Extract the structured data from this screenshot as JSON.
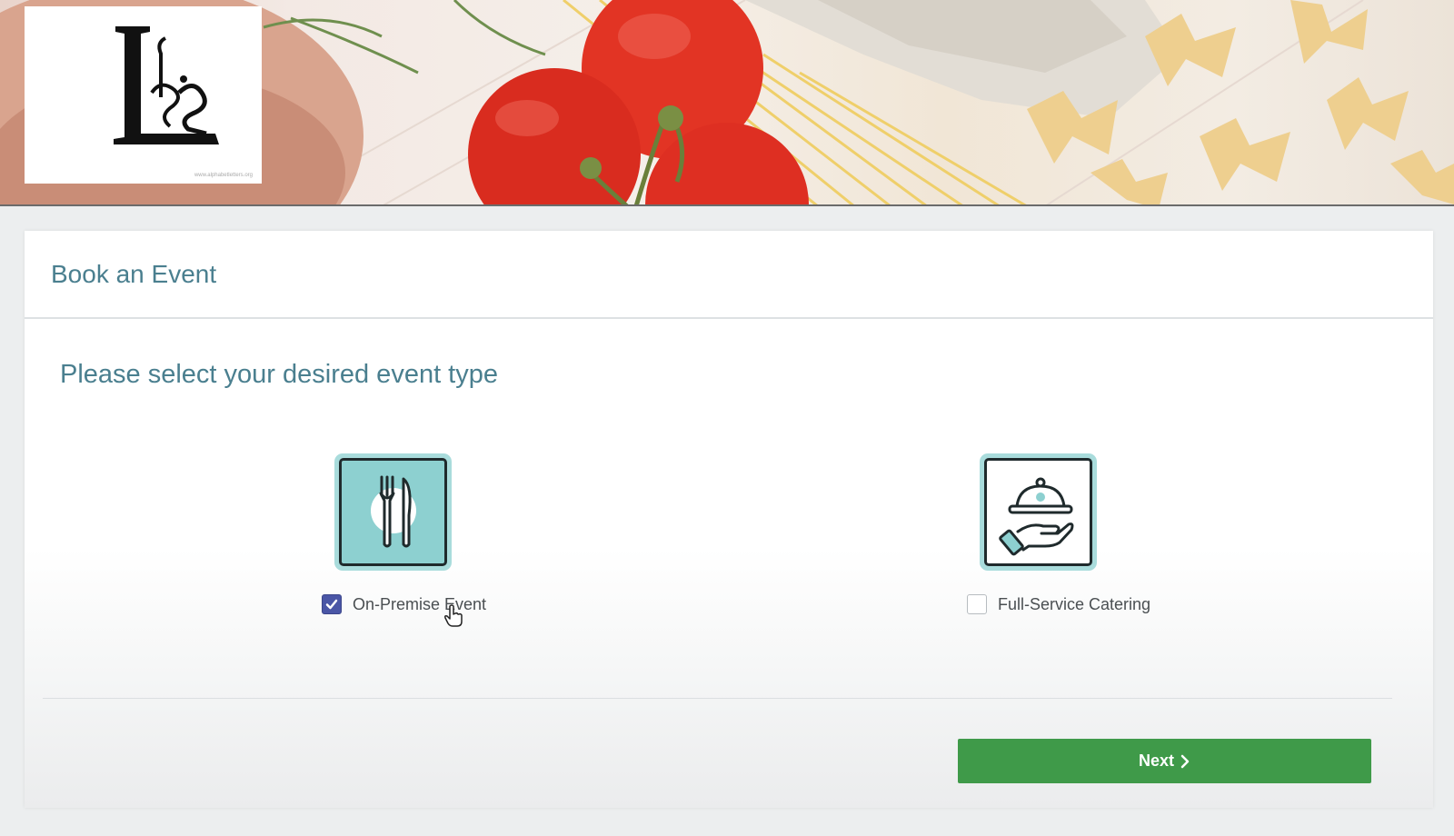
{
  "logo": {
    "credit": "www.alphabetletters.org"
  },
  "card": {
    "title": "Book an Event",
    "prompt": "Please select your desired event type"
  },
  "options": [
    {
      "label": "On-Premise Event",
      "icon": "fork-knife-plate-icon",
      "checked": true
    },
    {
      "label": "Full-Service Catering",
      "icon": "cloche-hand-icon",
      "checked": false
    }
  ],
  "actions": {
    "next_label": "Next"
  },
  "colors": {
    "accent_text": "#4a7f8f",
    "tile_bg": "#a9dcdc",
    "checkbox_checked": "#4a56a6",
    "next_button": "#3f9a49"
  }
}
